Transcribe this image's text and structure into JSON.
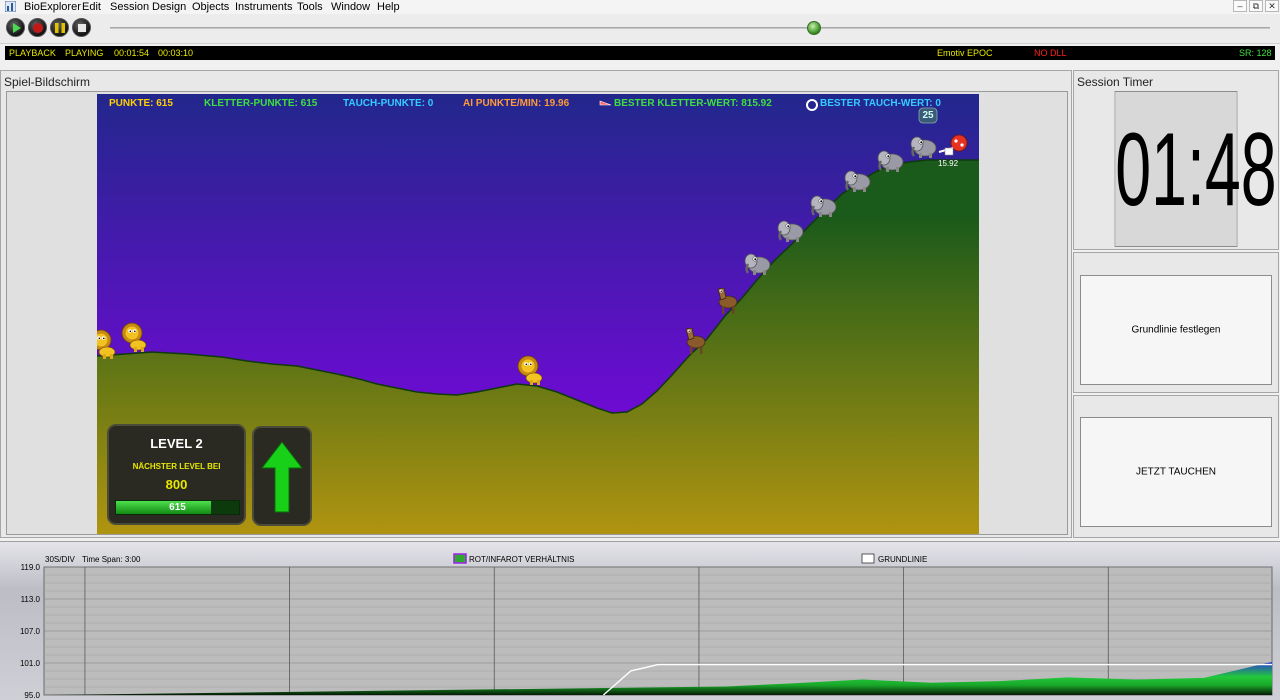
{
  "menu": {
    "items": [
      "BioExplorer",
      "Edit",
      "Session",
      "Design",
      "Objects",
      "Instruments",
      "Tools",
      "Window",
      "Help"
    ]
  },
  "window_buttons": [
    "–",
    "⧉",
    "✕"
  ],
  "transport": {
    "buttons": [
      "play-icon",
      "record-icon",
      "pause-icon",
      "stop-icon"
    ],
    "seek_position": 0.607
  },
  "status": {
    "mode": "PLAYBACK",
    "state": "PLAYING",
    "elapsed": "00:01:54",
    "total": "00:03:10",
    "device": "Emotiv EPOC",
    "dll": "NO DLL",
    "sample_rate": "SR: 128"
  },
  "game_panel": {
    "title": "Spiel-Bildschirm",
    "hud": {
      "points": "PUNKTE: 615",
      "climb_points": "KLETTER-PUNKTE: 615",
      "dive_points": "TAUCH-PUNKTE: 0",
      "ai_rate": "AI PUNKTE/MIN: 19.96",
      "best_climb": "BESTER KLETTER-WERT: 815.92",
      "best_dive": "BESTER TAUCH-WERT: 0"
    },
    "badge_number": "25",
    "player_value": "15.92",
    "level": {
      "title": "LEVEL 2",
      "next_label": "NÄCHSTER LEVEL BEI",
      "next_value": "800",
      "progress_value": 615,
      "progress_max": 800,
      "progress_text": "615"
    },
    "direction": "up-arrow-icon",
    "colors": {
      "sky_top": "#22278c",
      "sky_bottom": "#8a00ee",
      "ground_top": "#1a5a1a",
      "ground_bottom": "#b09410",
      "hud_yellow": "#ffd000",
      "hud_green": "#3ee03e",
      "hud_cyan": "#33ccff",
      "hud_orange": "#ff9a3a"
    }
  },
  "timer_panel": {
    "title": "Session Timer",
    "time": "01:48"
  },
  "baseline_button": {
    "label": "Grundlinie festlegen"
  },
  "dive_button": {
    "label": "JETZT TAUCHEN"
  },
  "chart_data": {
    "type": "area",
    "time_per_div": "30S/DIV",
    "time_span": "Time Span: 3:00",
    "legend": [
      {
        "name": "ROT/INFAROT VERHÄLTNIS",
        "color": "#2ea82e"
      },
      {
        "name": "GRUNDLINIE",
        "color": "#ffffff"
      }
    ],
    "y_ticks": [
      "119.0",
      "113.0",
      "107.0",
      "101.0",
      "95.0"
    ],
    "ylim": [
      95,
      119
    ],
    "grid": true,
    "series": [
      {
        "name": "ROT/INFAROT VERHÄLTNIS",
        "x": [
          0,
          100,
          105,
          110,
          120,
          130,
          140,
          150,
          160,
          170,
          180
        ],
        "values": [
          95.0,
          96.6,
          96.9,
          97.2,
          97.9,
          97.3,
          97.6,
          98.3,
          97.9,
          98.2,
          101.2
        ]
      },
      {
        "name": "GRUNDLINIE",
        "x": [
          82,
          86,
          90,
          100,
          180
        ],
        "values": [
          95.0,
          99.5,
          100.7,
          100.7,
          100.7
        ]
      }
    ]
  }
}
